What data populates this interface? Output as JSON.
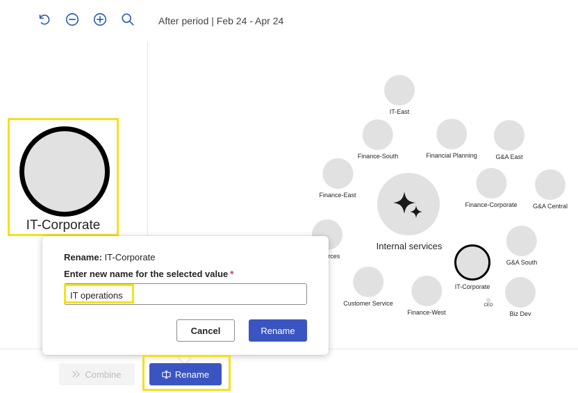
{
  "toolbar": {
    "undo_icon": "undo-icon",
    "zoom_out_icon": "zoom-out-icon",
    "zoom_in_icon": "zoom-in-icon",
    "search_icon": "search-icon",
    "period_text": "After period | Feb 24 - Apr 24"
  },
  "selected_node": {
    "label": "IT-Corporate"
  },
  "graph": {
    "center_label": "Internal services",
    "center_icon": "sparkle-icon",
    "nodes": [
      {
        "label": "IT-East"
      },
      {
        "label": "Finance-South"
      },
      {
        "label": "Financial Planning"
      },
      {
        "label": "G&A East"
      },
      {
        "label": "Finance-East"
      },
      {
        "label": "Finance-Corporate"
      },
      {
        "label": "G&A Central"
      },
      {
        "label": "esources"
      },
      {
        "label": "G&A South"
      },
      {
        "label": "IT-Corporate"
      },
      {
        "label": "Customer Service"
      },
      {
        "label": "Finance-West"
      },
      {
        "label": "CEO"
      },
      {
        "label": "Biz Dev"
      }
    ]
  },
  "dialog": {
    "title_prefix": "Rename:",
    "title_value": "IT-Corporate",
    "field_label": "Enter new name for the selected value",
    "required_mark": "*",
    "input_value": "IT operations",
    "cancel_label": "Cancel",
    "rename_label": "Rename"
  },
  "actions": {
    "combine_label": "Combine",
    "combine_icon": "merge-icon",
    "rename_label": "Rename",
    "rename_icon": "rename-icon"
  },
  "colors": {
    "accent": "#3a55c2",
    "highlight": "#f5e01c",
    "node_fill": "#e1e1e1",
    "toolbar_icon": "#2b5fb4"
  }
}
